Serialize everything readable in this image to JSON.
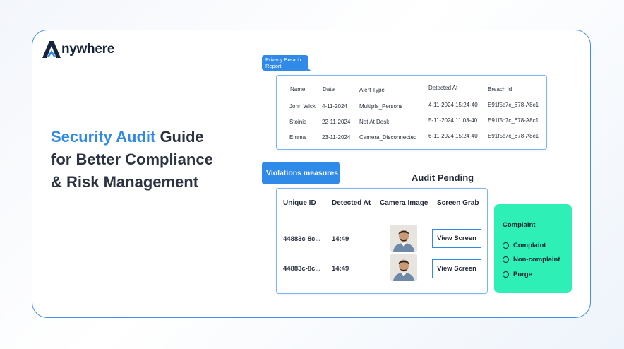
{
  "brand": {
    "name": "nywhere",
    "accent": "#2f8ae8"
  },
  "headline": {
    "accent": "Security Audit",
    "line1_rest": " Guide",
    "line2": "for Better Compliance",
    "line3": "& Risk Management"
  },
  "privacy": {
    "tag": "Privacy Breach Report",
    "columns": [
      "Name",
      "Date",
      "Alert Type",
      "Detected At",
      "Breach Id"
    ],
    "rows": [
      [
        "John Wick",
        "4-11-2024",
        "Multiple_Persons",
        "4-11-2024 15:24-40",
        "E91f5c7c_678-A8c1"
      ],
      [
        "Stoinis",
        "22-11-2024",
        "Not At Desk",
        "5-11-2024 11:03-40",
        "E91f5c7c_678-A8c1"
      ],
      [
        "Emma",
        "23-11-2024",
        "Camera_Disconnected",
        "6-11-2024 15:24-40",
        "E91f5c7c_678-A8c1"
      ]
    ]
  },
  "violations": {
    "tag": "Violations measures",
    "title": "Audit Pending",
    "columns": [
      "Unique ID",
      "Detected At",
      "Camera Image",
      "Screen Grab"
    ],
    "rows": [
      {
        "id": "44883c-8c...",
        "time": "14:49",
        "button": "View Screen"
      },
      {
        "id": "44883c-8c...",
        "time": "14:49",
        "button": "View Screen"
      }
    ]
  },
  "complaint": {
    "title": "Complaint",
    "options": [
      "Complaint",
      "Non-complaint",
      "Purge"
    ],
    "color": "#2ef0b6"
  }
}
